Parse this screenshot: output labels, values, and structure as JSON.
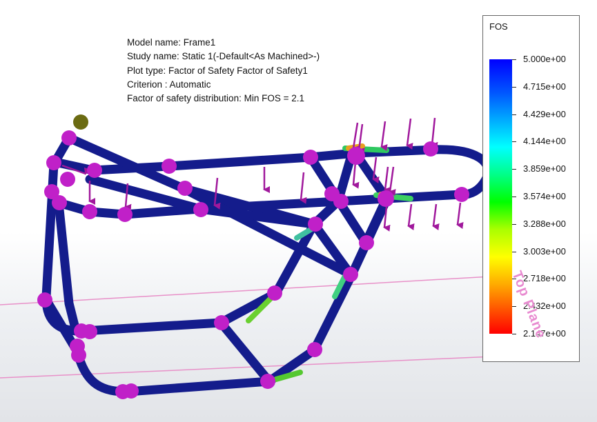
{
  "study_info": {
    "model_name": "Model name: Frame1",
    "study_name": "Study name: Static 1(-Default<As Machined>-)",
    "plot_type": "Plot type: Factor of Safety Factor of Safety1",
    "criterion": "Criterion : Automatic",
    "distribution": "Factor of safety distribution: Min FOS = 2.1"
  },
  "legend": {
    "title": "FOS",
    "labels": [
      "5.000e+00",
      "4.715e+00",
      "4.429e+00",
      "4.144e+00",
      "3.859e+00",
      "3.574e+00",
      "3.288e+00",
      "3.003e+00",
      "2.718e+00",
      "2.432e+00",
      "2.147e+00"
    ]
  },
  "plane": {
    "label": "Top Plane"
  },
  "colors": {
    "tube": "#141c8c",
    "fixture": "#c020c8",
    "load_arrow": "#a0189c",
    "plane_line": "#e890c8",
    "origin_ball": "#6b6b12"
  }
}
